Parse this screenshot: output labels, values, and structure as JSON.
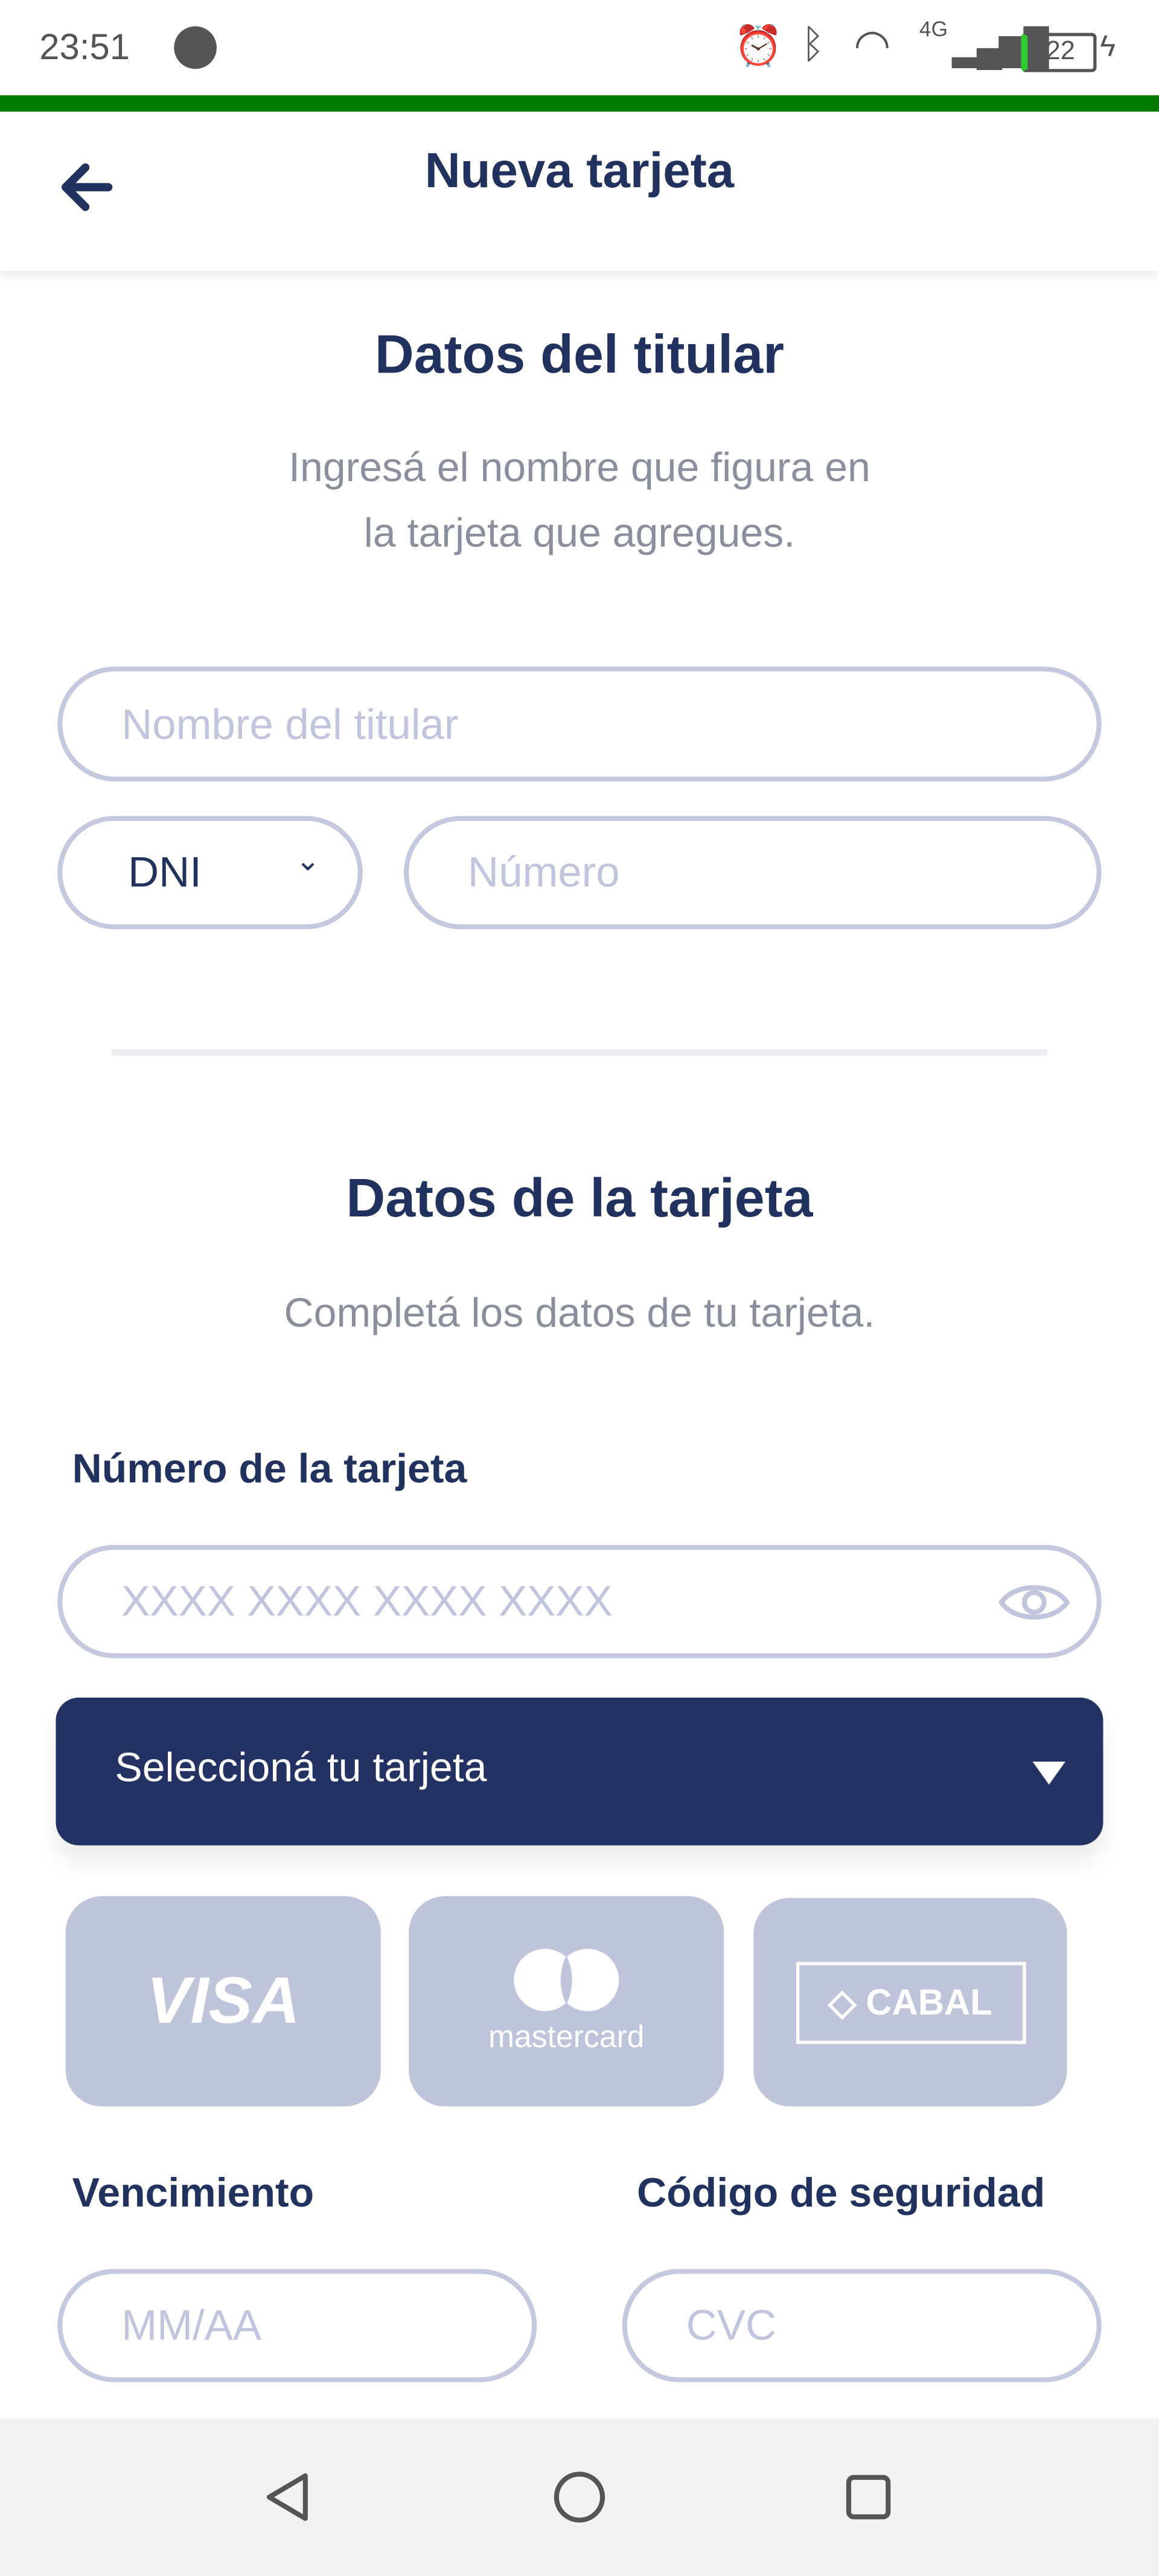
{
  "status_bar": {
    "time": "23:51",
    "network": "4G",
    "battery": "22"
  },
  "header": {
    "title": "Nueva tarjeta"
  },
  "holder": {
    "title": "Datos del titular",
    "subtitle_line1": "Ingresá el nombre que figura en",
    "subtitle_line2": "la tarjeta que agregues.",
    "name_placeholder": "Nombre del titular",
    "doc_type": "DNI",
    "number_placeholder": "Número"
  },
  "card": {
    "title": "Datos de la tarjeta",
    "subtitle": "Completá los datos de tu tarjeta.",
    "number_label": "Número de la tarjeta",
    "number_placeholder": "XXXX XXXX XXXX XXXX",
    "select_label": "Seleccioná tu tarjeta",
    "brands": [
      "VISA",
      "mastercard",
      "CABAL"
    ],
    "expiry_label": "Vencimiento",
    "expiry_placeholder": "MM/AA",
    "cvc_label": "Código de seguridad",
    "cvc_placeholder": "CVC"
  },
  "colors": {
    "primary": "#22325f",
    "accent_bar": "#007a00",
    "brand_tile": "#bec4da",
    "input_border": "#c5c9e0"
  }
}
